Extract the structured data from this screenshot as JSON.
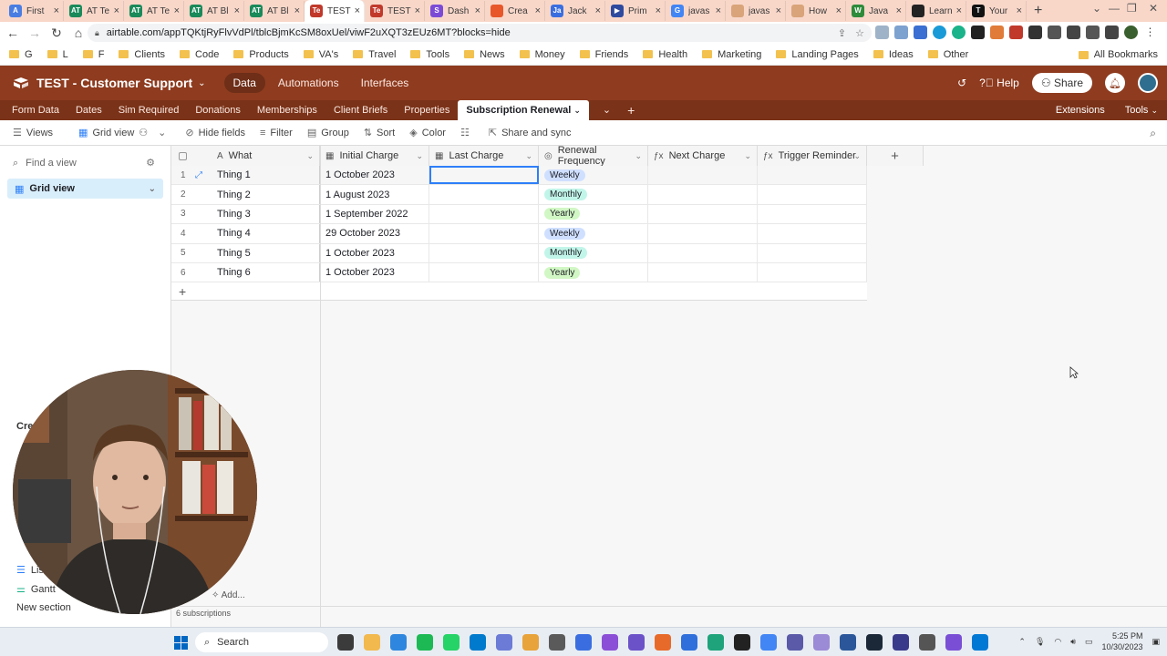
{
  "browser": {
    "tabs": [
      {
        "title": "First",
        "fav_color": "#4a7de2",
        "fav": "A"
      },
      {
        "title": "AT Te",
        "fav_color": "#1a8a5a",
        "fav": "AT"
      },
      {
        "title": "AT Te",
        "fav_color": "#1a8a5a",
        "fav": "AT"
      },
      {
        "title": "AT Bl",
        "fav_color": "#1a8a5a",
        "fav": "AT"
      },
      {
        "title": "AT Bl",
        "fav_color": "#1a8a5a",
        "fav": "AT"
      },
      {
        "title": "TEST",
        "fav_color": "#c0392b",
        "fav": "Te",
        "active": true
      },
      {
        "title": "TEST",
        "fav_color": "#c0392b",
        "fav": "Te"
      },
      {
        "title": "Dash",
        "fav_color": "#7b4bd6",
        "fav": "S"
      },
      {
        "title": "Crea",
        "fav_color": "#e8572a",
        "fav": ""
      },
      {
        "title": "Jack",
        "fav_color": "#3a6ee0",
        "fav": "Ja"
      },
      {
        "title": "Prim",
        "fav_color": "#2e4a9e",
        "fav": "▶"
      },
      {
        "title": "javas",
        "fav_color": "#4285f4",
        "fav": "G"
      },
      {
        "title": "javas",
        "fav_color": "#d9a47a",
        "fav": ""
      },
      {
        "title": "How",
        "fav_color": "#d9a47a",
        "fav": ""
      },
      {
        "title": "Java",
        "fav_color": "#2e8b3a",
        "fav": "W"
      },
      {
        "title": "Learn",
        "fav_color": "#222222",
        "fav": ""
      },
      {
        "title": "Your",
        "fav_color": "#111111",
        "fav": "T"
      }
    ],
    "url": "airtable.com/appTQKtjRyFlvVdPl/tblcBjmKcSM8oxUel/viwF2uXQT3zEUz6MT?blocks=hide",
    "bookmarks": [
      "G",
      "L",
      "F",
      "Clients",
      "Code",
      "Products",
      "VA's",
      "Travel",
      "Tools",
      "News",
      "Money",
      "Friends",
      "Health",
      "Marketing",
      "Landing Pages",
      "Ideas",
      "Other"
    ],
    "all_bookmarks": "All Bookmarks"
  },
  "app": {
    "base_title": "TEST - Customer Support",
    "topnav": [
      "Data",
      "Automations",
      "Interfaces"
    ],
    "help": "Help",
    "share": "Share",
    "tables": [
      "Form Data",
      "Dates",
      "Sim Required",
      "Donations",
      "Memberships",
      "Client Briefs",
      "Properties",
      "Subscription Renewal"
    ],
    "active_table": "Subscription Renewal",
    "extensions": "Extensions",
    "tools": "Tools"
  },
  "viewbar": {
    "views": "Views",
    "grid_view": "Grid view",
    "hide_fields": "Hide fields",
    "filter": "Filter",
    "group": "Group",
    "sort": "Sort",
    "color": "Color",
    "share_sync": "Share and sync"
  },
  "sidebar": {
    "find_placeholder": "Find a view",
    "active_view": "Grid view",
    "create_label": "Cre",
    "items": [
      "List",
      "Gantt"
    ],
    "new_section": "New section"
  },
  "grid": {
    "columns": [
      {
        "name": "What",
        "icon": "A"
      },
      {
        "name": "Initial Charge",
        "icon": "▦"
      },
      {
        "name": "Last Charge",
        "icon": "▦"
      },
      {
        "name": "Renewal Frequency",
        "icon": "◎"
      },
      {
        "name": "Next Charge",
        "icon": "ƒx"
      },
      {
        "name": "Trigger Reminder",
        "icon": "ƒx"
      }
    ],
    "rows": [
      {
        "n": "1",
        "what": "Thing 1",
        "initial": "1 October 2023",
        "last": "",
        "freq": "Weekly",
        "next": "",
        "trigger": ""
      },
      {
        "n": "2",
        "what": "Thing 2",
        "initial": "1 August 2023",
        "last": "",
        "freq": "Monthly",
        "next": "",
        "trigger": ""
      },
      {
        "n": "3",
        "what": "Thing 3",
        "initial": "1 September 2022",
        "last": "",
        "freq": "Yearly",
        "next": "",
        "trigger": ""
      },
      {
        "n": "4",
        "what": "Thing 4",
        "initial": "29 October 2023",
        "last": "",
        "freq": "Weekly",
        "next": "",
        "trigger": ""
      },
      {
        "n": "5",
        "what": "Thing 5",
        "initial": "1 October 2023",
        "last": "",
        "freq": "Monthly",
        "next": "",
        "trigger": ""
      },
      {
        "n": "6",
        "what": "Thing 6",
        "initial": "1 October 2023",
        "last": "",
        "freq": "Yearly",
        "next": "",
        "trigger": ""
      }
    ],
    "record_count": "6 subscriptions",
    "add_label": "Add..."
  },
  "taskbar": {
    "search": "Search",
    "time": "5:25 PM",
    "date": "10/30/2023"
  },
  "colors": {
    "header": "#8e3b1f",
    "tablebar": "#7a3218",
    "selection": "#2d7ff9",
    "weekly": "#cfdfff",
    "monthly": "#c2f5e9",
    "yearly": "#d1f7c4"
  }
}
